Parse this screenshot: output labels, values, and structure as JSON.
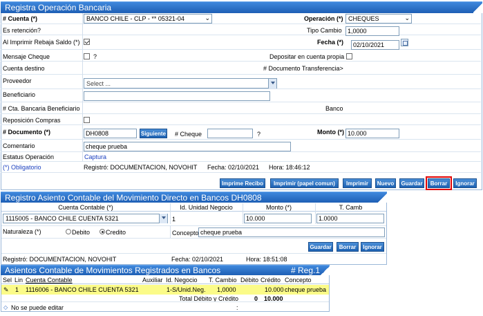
{
  "section1": {
    "title": "Registra Operación Bancaria",
    "cuenta_label": "# Cuenta (*)",
    "cuenta_value": "BANCO CHILE - CLP - ** 05321-04",
    "operacion_label": "Operación (*)",
    "operacion_value": "CHEQUES",
    "es_retencion_label": "Es retención?",
    "tipo_cambio_label": "Tipo Cambio",
    "tipo_cambio_value": "1,0000",
    "rebaja_saldo_label": "Al Imprimir Rebaja Saldo (*)",
    "fecha_label": "Fecha (*)",
    "fecha_value": "02/10/2021",
    "mensaje_cheque_label": "Mensaje Cheque",
    "mensaje_help": "?",
    "depositar_label": "Depositar en cuenta propia",
    "cuenta_destino_label": "Cuenta destino",
    "doc_transferencia_label": "# Documento Transferencia>",
    "proveedor_label": "Proveedor",
    "proveedor_placeholder": "Select ...",
    "beneficiario_label": "Beneficiario",
    "cta_bancaria_label": "# Cta. Bancaria Beneficiario",
    "banco_label": "Banco",
    "reposicion_label": "Reposición Compras",
    "documento_label": "# Documento (*)",
    "documento_value": "DH0808",
    "siguiente_label": "Siguiente",
    "cheque_label": "# Cheque",
    "cheque_help": "?",
    "monto_label": "Monto (*)",
    "monto_value": "10.000",
    "comentario_label": "Comentario",
    "comentario_value": "cheque prueba",
    "estatus_label": "Estatus Operación",
    "estatus_value": "Captura",
    "obligatorio": "(*) Obligatorio",
    "registro_text": "Registró: DOCUMENTACION, NOVOHIT",
    "fecha_text": "Fecha: 02/10/2021",
    "hora_text": "Hora: 18:46:12",
    "buttons": {
      "imprime_recibo": "Imprime Recibo",
      "imprimir_papel": "Imprimir (papel comun)",
      "imprimir": "Imprimir",
      "nuevo": "Nuevo",
      "guardar": "Guardar",
      "borrar": "Borrar",
      "ignorar": "Ignorar"
    }
  },
  "section2": {
    "title": "Registro Asiento Contable del Movimiento Directo en Bancos DH0808",
    "col_cuenta": "Cuenta Contable (*)",
    "col_unidad": "Id. Unidad Negocio",
    "col_monto": "Monto (*)",
    "col_tcamb": "T. Camb",
    "cuenta_value": "1115005 - BANCO CHILE CUENTA 5321",
    "unidad_value": "1",
    "monto_value": "10.000",
    "tcamb_value": "1.0000",
    "naturaleza_label": "Naturaleza (*)",
    "debito_label": "Debito",
    "credito_label": "Credito",
    "concepto_label": "Concepto",
    "concepto_value": "cheque prueba",
    "buttons": {
      "guardar": "Guardar",
      "borrar": "Borrar",
      "ignorar": "Ignorar"
    },
    "registro_text": "Registró: DOCUMENTACION, NOVOHIT",
    "fecha_text": "Fecha: 02/10/2021",
    "hora_text": "Hora: 18:51:08"
  },
  "section3": {
    "title": "Asientos Contable de Movimientos Registrados en Bancos",
    "reg_count": "# Reg.1",
    "headers": [
      "Sel",
      "Lin",
      "Cuenta Contable",
      "Auxiliar",
      "Id. Negocio",
      "T. Cambio",
      "Débito",
      "Crédito",
      "Concepto"
    ],
    "row": {
      "lin": "1",
      "cuenta": "1116006 - BANCO CHILE CUENTA 5321",
      "auxiliar": "",
      "negocio": "1-S/Unid.Neg.",
      "tcambio": "1,0000",
      "debito": "",
      "credito": "10.000",
      "concepto": "cheque prueba"
    },
    "total_label": "Total Débito y Crédito",
    "total_debito": "0",
    "total_credito": "10.000",
    "footer_text": "No se puede editar",
    "footer_colon": ":"
  }
}
